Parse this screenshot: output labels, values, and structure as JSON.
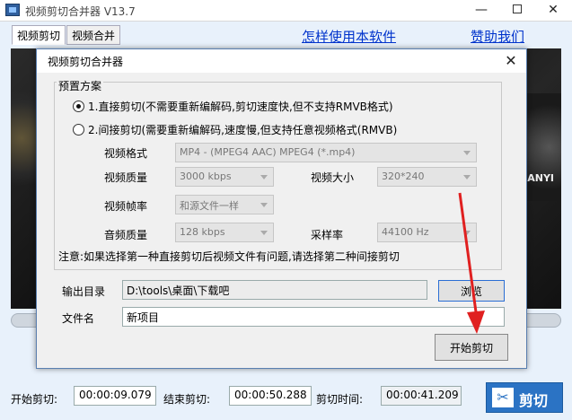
{
  "main_window": {
    "title": "视频剪切合并器 V13.7",
    "tabs": [
      {
        "label": "视频剪切"
      },
      {
        "label": "视频合并"
      }
    ],
    "links": {
      "how_to": "怎样使用本软件",
      "donate": "赞助我们"
    },
    "video_overlay_text": "ANYI",
    "bottom": {
      "start_label": "开始剪切:",
      "start_value": "00:00:09.079",
      "end_label": "结束剪切:",
      "end_value": "00:00:50.288",
      "duration_label": "剪切时间:",
      "duration_value": "00:00:41.209",
      "cut_button": "剪切"
    }
  },
  "dialog": {
    "title": "视频剪切合并器",
    "preset_group_title": "预置方案",
    "options": [
      {
        "label": "1.直接剪切(不需要重新编解码,剪切速度快,但不支持RMVB格式)",
        "checked": true
      },
      {
        "label": "2.间接剪切(需要重新编解码,速度慢,但支持任意视频格式(RMVB)",
        "checked": false
      }
    ],
    "fields": {
      "format_label": "视频格式",
      "format_value": "MP4 - (MPEG4 AAC) MPEG4 (*.mp4)",
      "quality_label": "视频质量",
      "quality_value": "3000 kbps",
      "size_label": "视频大小",
      "size_value": "320*240",
      "fps_label": "视频帧率",
      "fps_value": "和源文件一样",
      "audio_label": "音频质量",
      "audio_value": "128 kbps",
      "samplerate_label": "采样率",
      "samplerate_value": "44100 Hz"
    },
    "notice": "注意:如果选择第一种直接剪切后视频文件有问题,请选择第二种间接剪切",
    "output_dir_label": "输出目录",
    "output_dir_value": "D:\\tools\\桌面\\下载吧",
    "browse_button": "浏览",
    "filename_label": "文件名",
    "filename_value": "新项目",
    "start_button": "开始剪切"
  },
  "colors": {
    "accent": "#2b73c4",
    "link": "#0033cc",
    "annotation_arrow": "#e02020"
  }
}
